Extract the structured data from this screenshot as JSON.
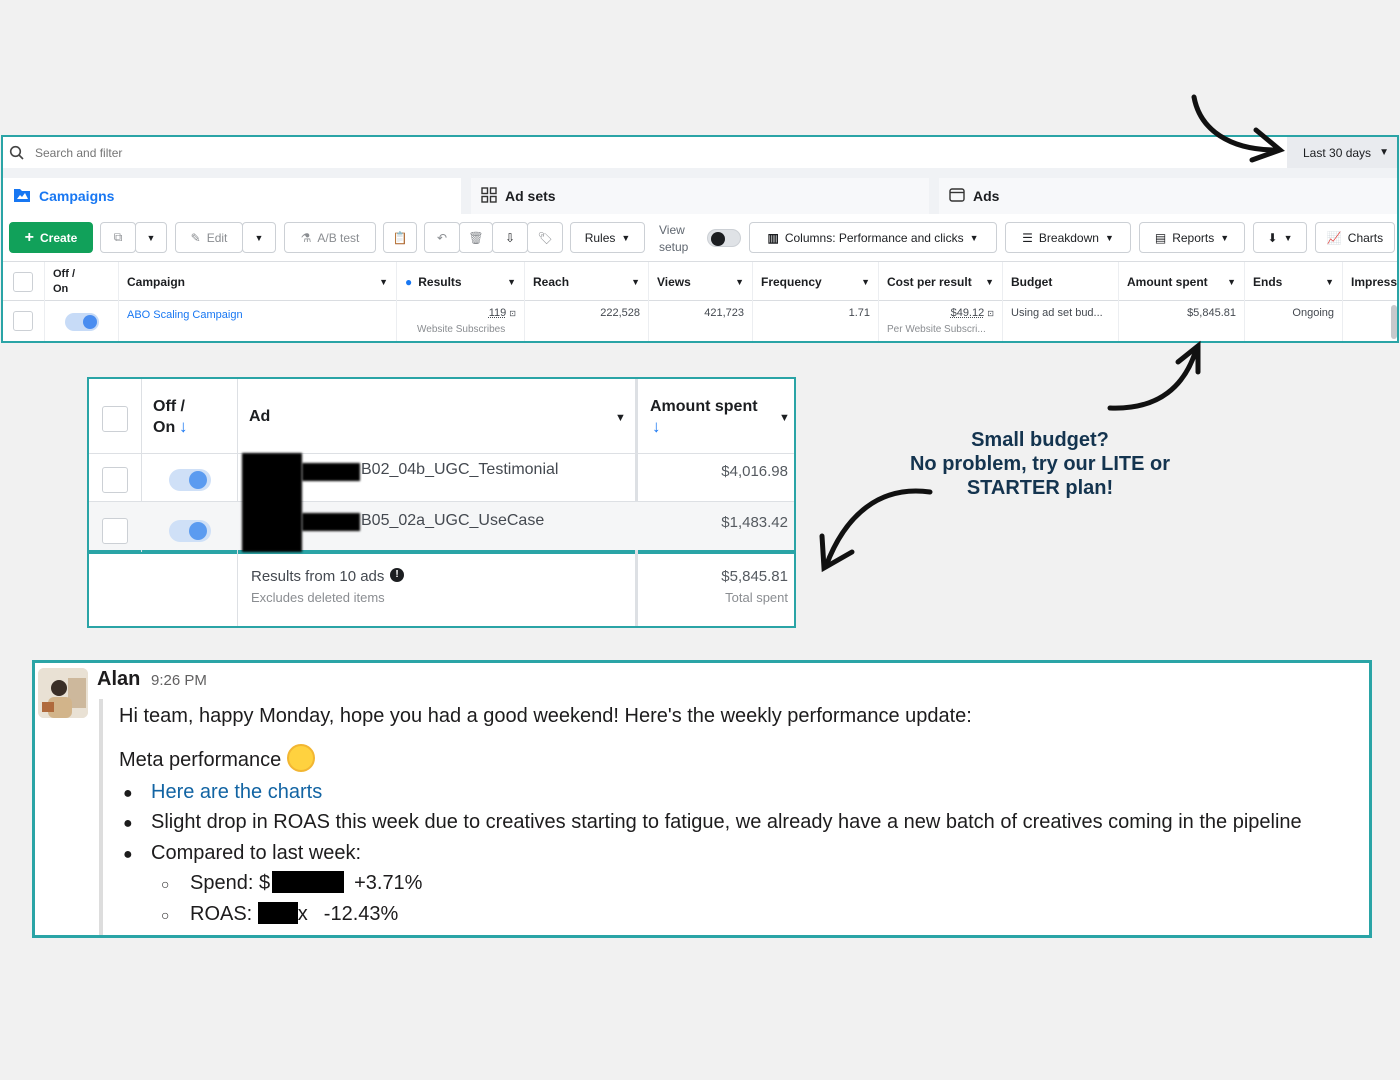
{
  "ads_manager": {
    "search_placeholder": "Search and filter",
    "date_range": "Last 30 days",
    "tabs": [
      {
        "label": "Campaigns",
        "icon": "folder-icon"
      },
      {
        "label": "Ad sets",
        "icon": "grid-icon"
      },
      {
        "label": "Ads",
        "icon": "ad-window-icon"
      }
    ],
    "toolbar": {
      "create": "Create",
      "edit": "Edit",
      "ab_test": "A/B test",
      "rules": "Rules",
      "view_setup_1": "View",
      "view_setup_2": "setup",
      "columns": "Columns: Performance and clicks",
      "breakdown": "Breakdown",
      "reports": "Reports",
      "charts": "Charts"
    },
    "columns": [
      "Off / On",
      "Campaign",
      "Results",
      "Reach",
      "Views",
      "Frequency",
      "Cost per result",
      "Budget",
      "Amount spent",
      "Ends",
      "Impressi"
    ],
    "row": {
      "campaign": "ABO Scaling Campaign",
      "results": "119",
      "results_sub": "Website Subscribes",
      "reach": "222,528",
      "views": "421,723",
      "frequency": "1.71",
      "cost_per_result": "$49.12",
      "cost_sub": "Per Website Subscri...",
      "budget": "Using ad set bud...",
      "amount_spent": "$5,845.81",
      "ends": "Ongoing"
    }
  },
  "ads_table": {
    "col_toggle_1": "Off /",
    "col_toggle_2": "On",
    "col_ad": "Ad",
    "col_amount": "Amount spent",
    "rows": [
      {
        "name": "B02_04b_UGC_Testimonial",
        "amount": "$4,016.98"
      },
      {
        "name": "B05_02a_UGC_UseCase",
        "amount": "$1,483.42"
      }
    ],
    "summary_label": "Results from 10 ads",
    "summary_sub": "Excludes deleted items",
    "summary_amount": "$5,845.81",
    "summary_amount_sub": "Total spent"
  },
  "callout": {
    "line1": "Small budget?",
    "line2": "No problem, try our LITE or",
    "line3": "STARTER plan!"
  },
  "message": {
    "author": "Alan",
    "time": "9:26 PM",
    "greeting": "Hi team, happy Monday, hope you had a good weekend! Here's the weekly performance update:",
    "heading": "Meta performance",
    "bullets": [
      "Here are the charts",
      "Slight drop in ROAS this week due to creatives starting to fatigue, we already have a new batch of creatives coming in the pipeline",
      "Compared to last week:"
    ],
    "sub_bullets": [
      {
        "label": "Spend: $",
        "change": "+3.71%"
      },
      {
        "label": "ROAS: ",
        "suffix": "x",
        "change": "-12.43%"
      }
    ]
  },
  "colors": {
    "accent_frame": "#2aa4a6",
    "facebook_blue": "#1877f2",
    "create_green": "#11a15a",
    "callout_navy": "#14344f"
  }
}
